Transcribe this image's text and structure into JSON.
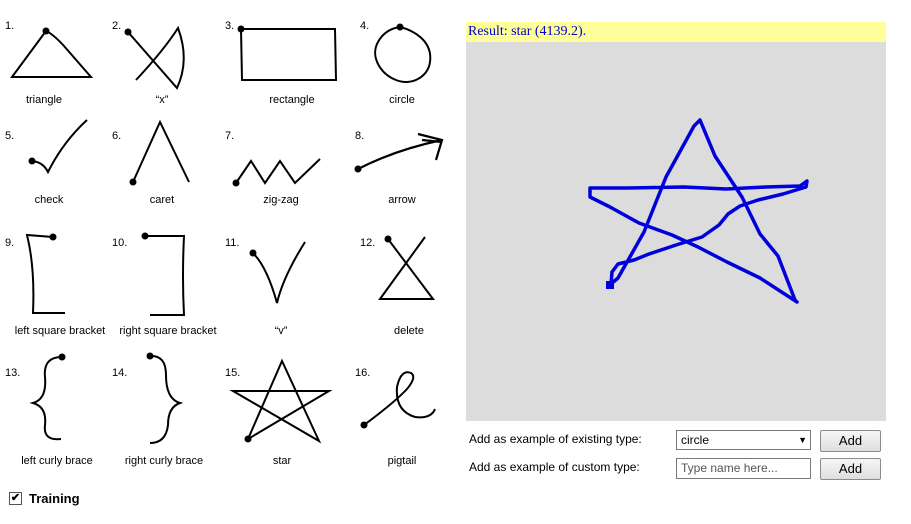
{
  "gestures": [
    {
      "num": "1.",
      "label": "triangle"
    },
    {
      "num": "2.",
      "label": "“x”"
    },
    {
      "num": "3.",
      "label": "rectangle"
    },
    {
      "num": "4.",
      "label": "circle"
    },
    {
      "num": "5.",
      "label": "check"
    },
    {
      "num": "6.",
      "label": "caret"
    },
    {
      "num": "7.",
      "label": "zig-zag"
    },
    {
      "num": "8.",
      "label": "arrow"
    },
    {
      "num": "9.",
      "label": "left square bracket"
    },
    {
      "num": "10.",
      "label": "right square bracket"
    },
    {
      "num": "11.",
      "label": "“v”"
    },
    {
      "num": "12.",
      "label": "delete"
    },
    {
      "num": "13.",
      "label": "left curly brace"
    },
    {
      "num": "14.",
      "label": "right curly brace"
    },
    {
      "num": "15.",
      "label": "star"
    },
    {
      "num": "16.",
      "label": "pigtail"
    }
  ],
  "result": {
    "text": "Result: star (4139.2)."
  },
  "existing_type": {
    "label": "Add as example of existing type:",
    "selected": "circle",
    "button": "Add"
  },
  "custom_type": {
    "label": "Add as example of custom type:",
    "placeholder": "Type name here...",
    "button": "Add"
  },
  "training": {
    "label": "Training",
    "checked": true
  },
  "colors": {
    "stroke": "#0000dd",
    "canvas": "#dcdcdc",
    "result_bg": "#ffff99"
  }
}
